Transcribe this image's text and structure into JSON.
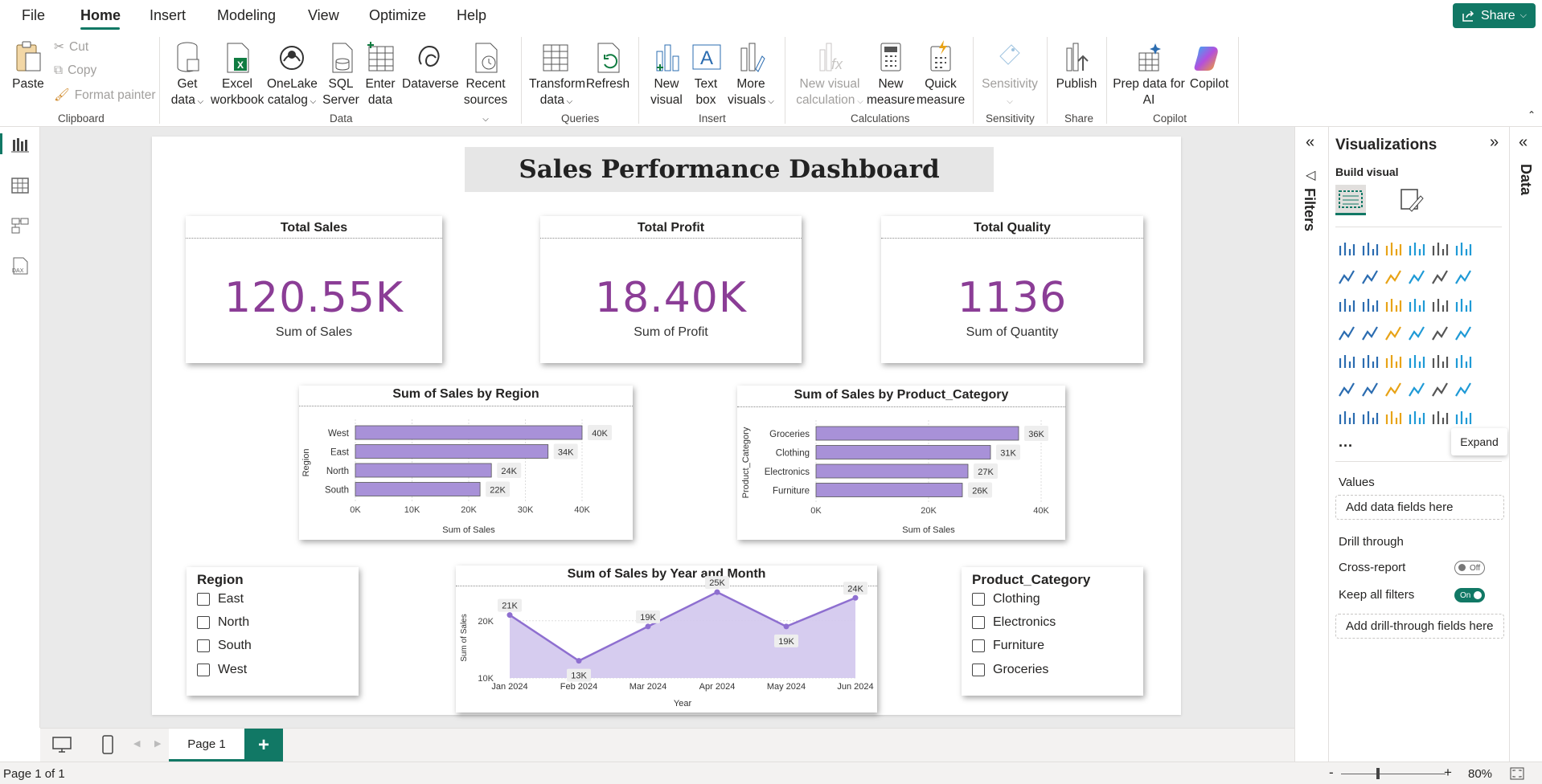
{
  "menu": {
    "items": [
      "File",
      "Home",
      "Insert",
      "Modeling",
      "View",
      "Optimize",
      "Help"
    ],
    "share": "Share"
  },
  "ribbon": {
    "paste": "Paste",
    "cut": "Cut",
    "copy": "Copy",
    "format_painter": "Format painter",
    "get_data": [
      "Get",
      "data"
    ],
    "excel": [
      "Excel",
      "workbook"
    ],
    "onelake": [
      "OneLake",
      "catalog"
    ],
    "sql": [
      "SQL",
      "Server"
    ],
    "enter": [
      "Enter",
      "data"
    ],
    "dataverse": "Dataverse",
    "recent": [
      "Recent",
      "sources"
    ],
    "transform": [
      "Transform",
      "data"
    ],
    "refresh": "Refresh",
    "new_visual": [
      "New",
      "visual"
    ],
    "text_box": [
      "Text",
      "box"
    ],
    "more_visuals": [
      "More",
      "visuals"
    ],
    "new_calc": [
      "New visual",
      "calculation"
    ],
    "new_measure": [
      "New",
      "measure"
    ],
    "quick_measure": [
      "Quick",
      "measure"
    ],
    "sensitivity": "Sensitivity",
    "publish": "Publish",
    "prep_copilot": [
      "Prep data for",
      "AI"
    ],
    "copilot": "Copilot",
    "groups": {
      "clipboard": "Clipboard",
      "data": "Data",
      "queries": "Queries",
      "insert": "Insert",
      "calculations": "Calculations",
      "sensitivity": "Sensitivity",
      "share": "Share",
      "copilot": "Copilot"
    }
  },
  "report": {
    "title": "Sales Performance Dashboard",
    "kpis": [
      {
        "title": "Total Sales",
        "value": "120.55K",
        "subtitle": "Sum of Sales"
      },
      {
        "title": "Total Profit",
        "value": "18.40K",
        "subtitle": "Sum of Profit"
      },
      {
        "title": "Total Quality",
        "value": "1136",
        "subtitle": "Sum of Quantity"
      }
    ],
    "slicer_region": {
      "title": "Region",
      "items": [
        "East",
        "North",
        "South",
        "West"
      ]
    },
    "slicer_category": {
      "title": "Product_Category",
      "items": [
        "Clothing",
        "Electronics",
        "Furniture",
        "Groceries"
      ]
    }
  },
  "chart_data": [
    {
      "type": "bar",
      "title": "Sum of Sales by Region",
      "ylabel": "Region",
      "xlabel": "Sum of Sales",
      "categories": [
        "West",
        "East",
        "North",
        "South"
      ],
      "values": [
        40,
        34,
        24,
        22
      ],
      "data_labels": [
        "40K",
        "34K",
        "24K",
        "22K"
      ],
      "ticks": [
        "0K",
        "10K",
        "20K",
        "30K",
        "40K"
      ],
      "xlim": [
        0,
        40
      ],
      "color": "#a891d8"
    },
    {
      "type": "bar",
      "title": "Sum of Sales by Product_Category",
      "ylabel": "Product_Category",
      "xlabel": "Sum of Sales",
      "categories": [
        "Groceries",
        "Clothing",
        "Electronics",
        "Furniture"
      ],
      "values": [
        36,
        31,
        27,
        26
      ],
      "data_labels": [
        "36K",
        "31K",
        "27K",
        "26K"
      ],
      "ticks": [
        "0K",
        "20K",
        "40K"
      ],
      "xlim": [
        0,
        40
      ],
      "color": "#a891d8"
    },
    {
      "type": "area",
      "title": "Sum of Sales by Year and Month",
      "ylabel": "Sum of Sales",
      "xlabel": "Year",
      "categories": [
        "Jan 2024",
        "Feb 2024",
        "Mar 2024",
        "Apr 2024",
        "May 2024",
        "Jun 2024"
      ],
      "values": [
        21,
        13,
        19,
        25,
        19,
        24
      ],
      "data_labels": [
        "21K",
        "13K",
        "19K",
        "25K",
        "19K",
        "24K"
      ],
      "yticks": [
        "10K",
        "20K"
      ],
      "ylim": [
        10,
        26
      ],
      "color": "#8e6fd0"
    }
  ],
  "pages": {
    "tab": "Page 1"
  },
  "status": {
    "page": "Page 1 of 1",
    "zoom": "80%"
  },
  "panes": {
    "filters": "Filters",
    "visualizations": "Visualizations",
    "build_visual": "Build visual",
    "data": "Data",
    "values": "Values",
    "add_data_fields": "Add data fields here",
    "drill_through": "Drill through",
    "cross_report": "Cross-report",
    "cross_state": "Off",
    "keep_all_filters": "Keep all filters",
    "keep_state": "On",
    "add_drill": "Add drill-through fields here",
    "expand_tooltip": "Expand",
    "more": "..."
  }
}
